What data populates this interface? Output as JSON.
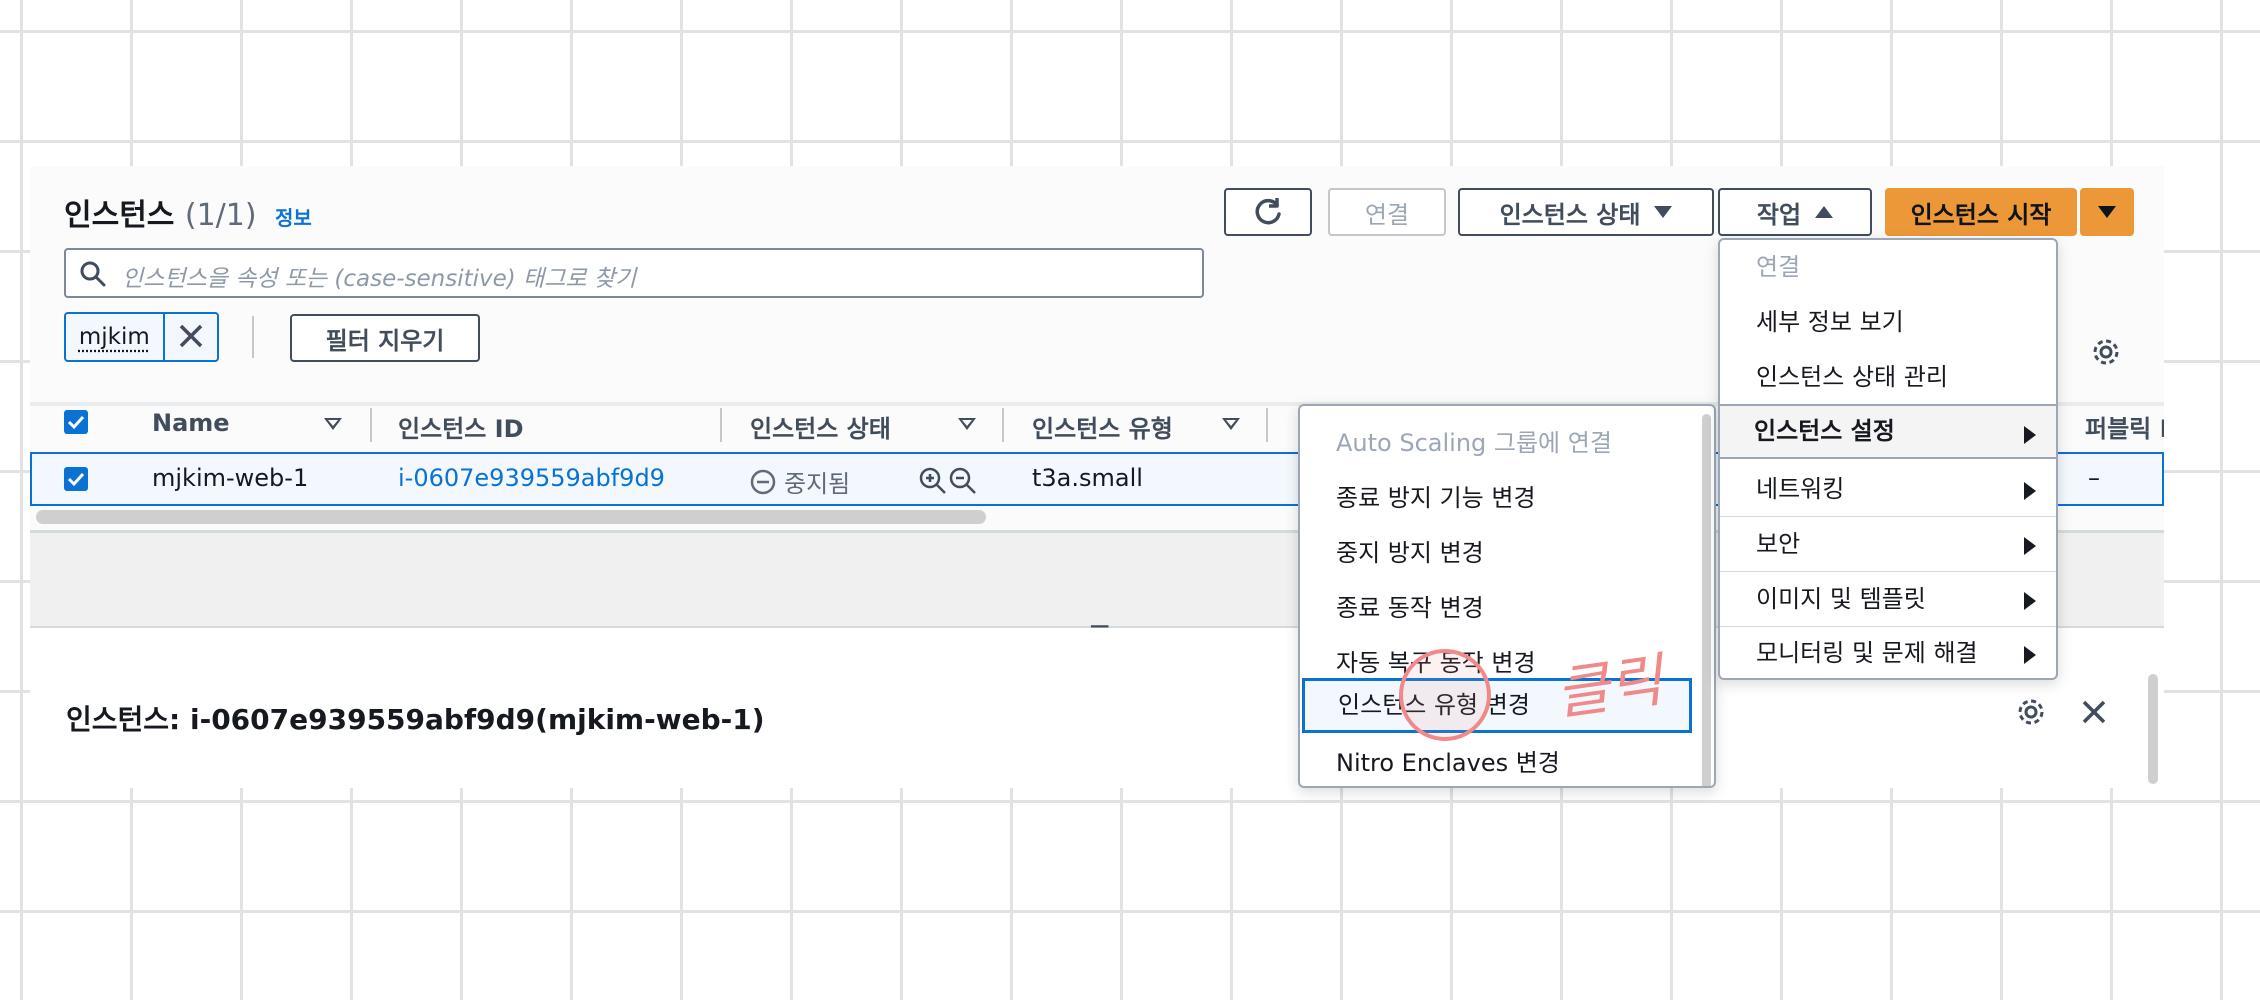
{
  "instances_panel": {
    "title": "인스턴스",
    "count": "(1/1)",
    "info_link": "정보",
    "search_placeholder": "인스턴스을 속성 또는 (case-sensitive) 태그로 찾기",
    "filter_token": "mjkim",
    "clear_filters": "필터 지우기"
  },
  "toolbar": {
    "connect": "연결",
    "instance_state": "인스턴스 상태",
    "actions": "작업",
    "launch": "인스턴스 시작"
  },
  "table": {
    "columns": [
      "Name",
      "인스턴스 ID",
      "인스턴스 상태",
      "인스턴스 유형",
      "퍼블릭 I"
    ],
    "rows": [
      {
        "name": "mjkim-web-1",
        "instance_id": "i-0607e939559abf9d9",
        "state": "중지됨",
        "type": "t3a.small",
        "public": "–"
      }
    ]
  },
  "actions_menu": {
    "items": [
      {
        "label": "연결",
        "disabled": true
      },
      {
        "label": "세부 정보 보기"
      },
      {
        "label": "인스턴스 상태 관리"
      },
      {
        "label": "인스턴스 설정",
        "active": true,
        "submenu": true
      },
      {
        "label": "네트워킹",
        "submenu": true
      },
      {
        "label": "보안",
        "submenu": true
      },
      {
        "label": "이미지 및 템플릿",
        "submenu": true
      },
      {
        "label": "모니터링 및 문제 해결",
        "submenu": true
      }
    ]
  },
  "settings_submenu": {
    "items": [
      {
        "label": "Auto Scaling 그룹에 연결",
        "disabled": true
      },
      {
        "label": "종료 방지 기능 변경"
      },
      {
        "label": "중지 방지 변경"
      },
      {
        "label": "종료 동작 변경"
      },
      {
        "label": "자동 복구 동작 변경"
      },
      {
        "label": "인스턴스 유형 변경",
        "selected": true
      },
      {
        "label": "Nitro Enclaves 변경"
      }
    ]
  },
  "details": {
    "title": "인스턴스: i-0607e939559abf9d9(mjkim-web-1)",
    "drag_handle": "="
  },
  "annotation": "클릭",
  "colors": {
    "accent": "#0972d3",
    "primary_button": "#ec9838",
    "annotation": "#f08a8a",
    "grid": "#e2e2e2"
  }
}
